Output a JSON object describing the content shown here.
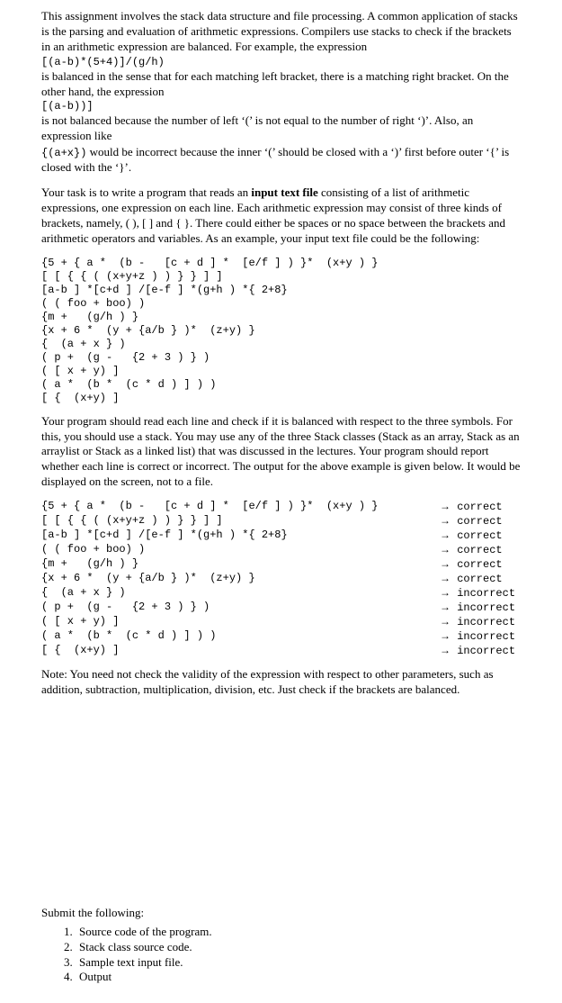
{
  "intro": {
    "p1_a": "This assignment involves the stack data structure and file processing. A common application of stacks is the parsing and evaluation of arithmetic expressions. Compilers use stacks to check if the brackets in an arithmetic expression are balanced. For example, the expression",
    "expr1": "[(a-b)*(5+4)]/(g/h)",
    "p2": "is balanced in the sense that for each matching left bracket, there is a matching right bracket. On the other hand, the expression",
    "expr2": "[(a-b))]",
    "p3": "is not balanced because the number of left ‘(’ is not equal to the number of right ‘)’.  Also, an expression like",
    "expr3": "{(a+x})",
    "p3b": " would be incorrect because the inner ‘(’ should be closed with a ‘)’ first before outer ‘{’ is closed with the ‘}’."
  },
  "task": {
    "p1_a": "Your task is to write a program that reads an ",
    "p1_bold": "input text file",
    "p1_b": " consisting of a list of arithmetic expressions, one expression on each line. Each arithmetic expression may consist of three kinds of brackets, namely, ( ), [ ] and { }. There could either be spaces or no space between the brackets and arithmetic operators and variables. As an example, your input text file could be the following:"
  },
  "input_lines": [
    "{5 + { a *  (b -   [c + d ] *  [e/f ] ) }*  (x+y ) }",
    "[ [ { { ( (x+y+z ) ) } } ] ]",
    "[a-b ] *[c+d ] /[e-f ] *(g+h ) *{ 2+8}",
    "( ( foo + boo) )",
    "{m +   (g/h ) }",
    "{x + 6 *  (y + {a/b } )*  (z+y) }",
    "{  (a + x } )",
    "( p +  (g -   {2 + 3 ) } )",
    "( [ x + y) ]",
    "( a *  (b *  (c * d ) ] ) )",
    "[ {  (x+y) ]"
  ],
  "mid": {
    "p1": "Your program should read each line and check if it is balanced with respect to the three symbols. For this, you should use a stack. You may use any of the three Stack classes (Stack as an array, Stack as an arraylist or Stack as a linked list) that was discussed in the lectures. Your program should report whether each line is correct or incorrect. The output for the above example is given below. It would be displayed on the screen, not to a file."
  },
  "results": [
    {
      "expr": "{5 + { a *  (b -   [c + d ] *  [e/f ] ) }*  (x+y ) }",
      "status": "correct"
    },
    {
      "expr": "[ [ { { ( (x+y+z ) ) } } ] ]",
      "status": "correct"
    },
    {
      "expr": "[a-b ] *[c+d ] /[e-f ] *(g+h ) *{ 2+8}",
      "status": "correct"
    },
    {
      "expr": "( ( foo + boo) )",
      "status": "correct"
    },
    {
      "expr": "{m +   (g/h ) }",
      "status": "correct"
    },
    {
      "expr": "{x + 6 *  (y + {a/b } )*  (z+y) }",
      "status": "correct"
    },
    {
      "expr": "{  (a + x } )",
      "status": "incorrect"
    },
    {
      "expr": "( p +  (g -   {2 + 3 ) } )",
      "status": "incorrect"
    },
    {
      "expr": "( [ x + y) ]",
      "status": "incorrect"
    },
    {
      "expr": "( a *  (b *  (c * d ) ] ) )",
      "status": "incorrect"
    },
    {
      "expr": "[ {  (x+y) ]",
      "status": "incorrect"
    }
  ],
  "note": "Note: You need not check the validity of the expression with respect to other parameters, such as addition, subtraction, multiplication, division, etc. Just check if the brackets are balanced.",
  "submit": {
    "heading": "Submit the following:",
    "items": [
      "Source code of the program.",
      "Stack class source code.",
      "Sample text input file.",
      "Output"
    ]
  },
  "arrow": "→"
}
